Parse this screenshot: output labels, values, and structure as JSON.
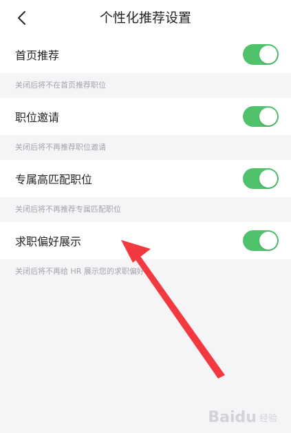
{
  "header": {
    "title": "个性化推荐设置",
    "back_icon": "chevron-left-icon"
  },
  "settings": [
    {
      "label": "首页推荐",
      "enabled": true,
      "hint": "关闭后将不在首页推荐职位"
    },
    {
      "label": "职位邀请",
      "enabled": true,
      "hint": "关闭后将不再推荐职位邀请"
    },
    {
      "label": "专属高匹配职位",
      "enabled": true,
      "hint": "关闭后将不再推荐专属匹配职位"
    },
    {
      "label": "求职偏好展示",
      "enabled": true,
      "hint": "关闭后将不再给 HR 展示您的求职偏好"
    }
  ],
  "watermark": {
    "brand": "Baidu",
    "sub": "经验"
  },
  "colors": {
    "toggle_on": "#4fc26b",
    "annotation_arrow": "#f2393f",
    "background": "#f5f5f7"
  }
}
